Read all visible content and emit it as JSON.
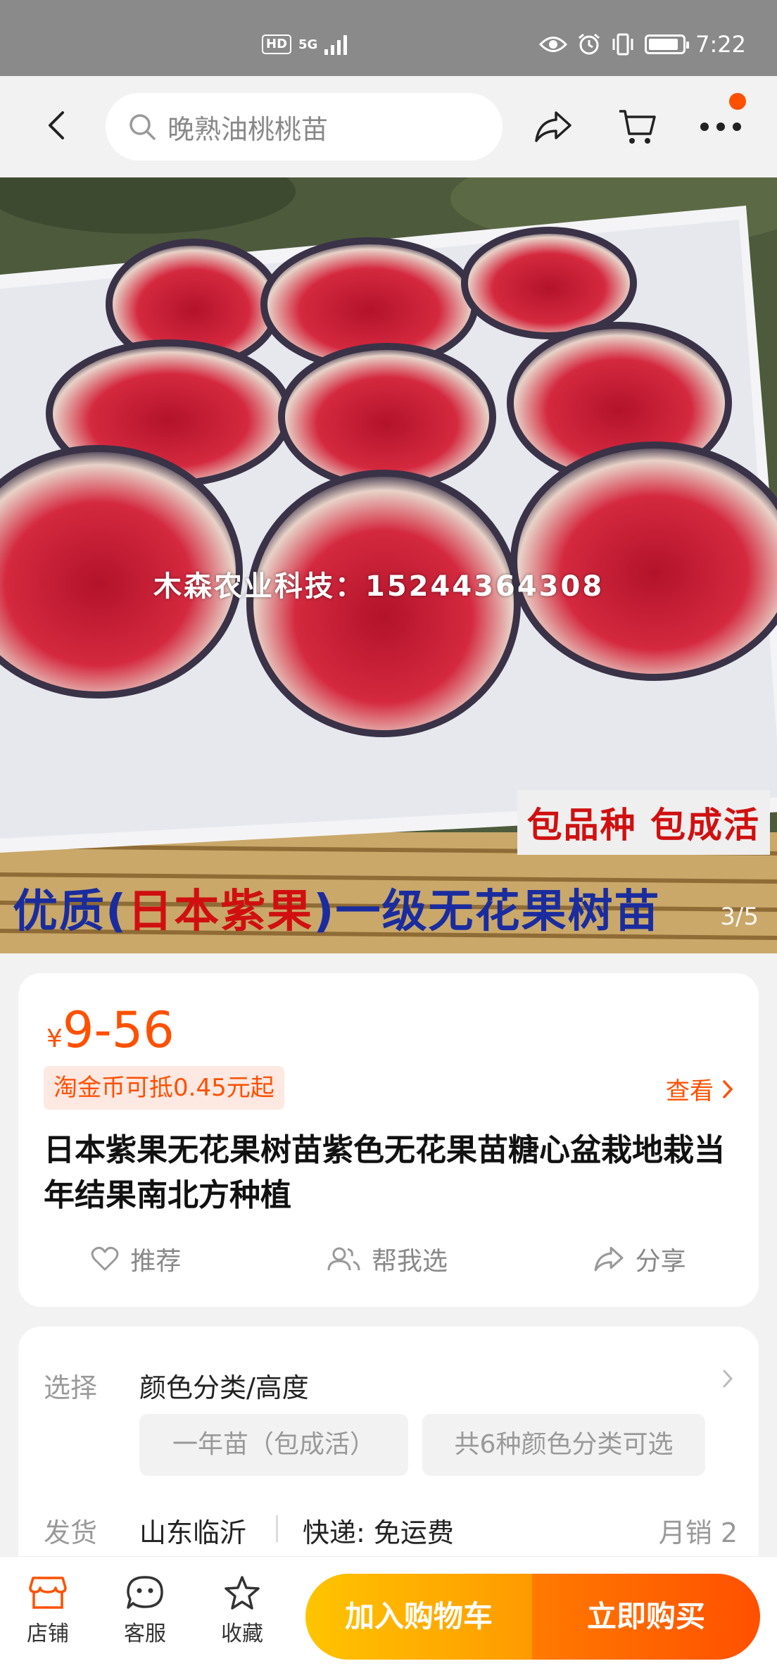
{
  "status_bar": {
    "hd": "HD",
    "signal": "5G",
    "time": "7:22"
  },
  "header": {
    "search_placeholder": "晚熟油桃桃苗"
  },
  "hero": {
    "watermark": "木森农业科技：15244364308",
    "promo_badge": "包品种 包成活",
    "banner_part1": "优质(",
    "banner_part2": "日本紫果",
    "banner_part3": ")一级无花果树苗",
    "page_indicator": "3/5"
  },
  "product": {
    "currency": "¥",
    "price": "9-56",
    "coin_tag": "淘金币可抵0.45元起",
    "view_link": "查看",
    "title": "日本紫果无花果树苗紫色无花果苗糖心盆栽地栽当年结果南北方种植",
    "actions": {
      "recommend": "推荐",
      "help_choose": "帮我选",
      "share": "分享"
    }
  },
  "options": {
    "select_label": "选择",
    "select_value": "颜色分类/高度",
    "chips": [
      "一年苗（包成活）",
      "共6种颜色分类可选"
    ],
    "ship_label": "发货",
    "ship_location": "山东临沂",
    "ship_method": "快递: 免运费",
    "monthly_sales": "月销  2"
  },
  "bottom_bar": {
    "shop": "店铺",
    "service": "客服",
    "favorite": "收藏",
    "add_to_cart": "加入购物车",
    "buy_now": "立即购买"
  },
  "colors": {
    "accent": "#ff5000",
    "cart_gradient_start": "#ffc400",
    "buy_gradient_end": "#ff5000"
  }
}
